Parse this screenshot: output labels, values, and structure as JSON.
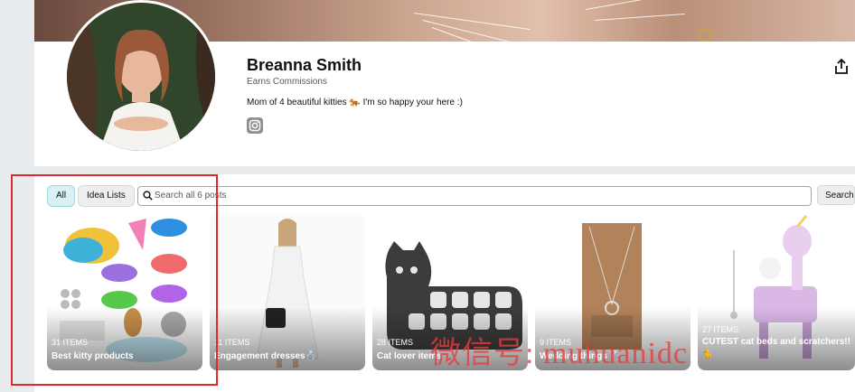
{
  "profile": {
    "name": "Breanna Smith",
    "earns": "Earns Commissions",
    "bio": "Mom of 4 beautiful kitties 🐅 I'm so happy your here :)",
    "social_icon": "instagram-icon",
    "share_icon": "share-icon"
  },
  "filters": {
    "all_label": "All",
    "idea_lists_label": "Idea Lists"
  },
  "search": {
    "placeholder": "Search all 6 posts",
    "button_label": "Search"
  },
  "tiles": [
    {
      "count": "31 ITEMS",
      "title": "Best kitty products"
    },
    {
      "count": "11 ITEMS",
      "title": "Engagement dresses💍"
    },
    {
      "count": "28 ITEMS",
      "title": "Cat lover items"
    },
    {
      "count": "9 ITEMS",
      "title": "Wedding things 💍"
    },
    {
      "count": "27 ITEMS",
      "title": "CUTEST cat beds and scratchers!! 🐈"
    }
  ],
  "watermark": "微信号: muhuanidc",
  "colors": {
    "highlight_box": "#e02a2a",
    "all_pill_bg": "#d9f1f4",
    "watermark": "#e63c3c"
  }
}
